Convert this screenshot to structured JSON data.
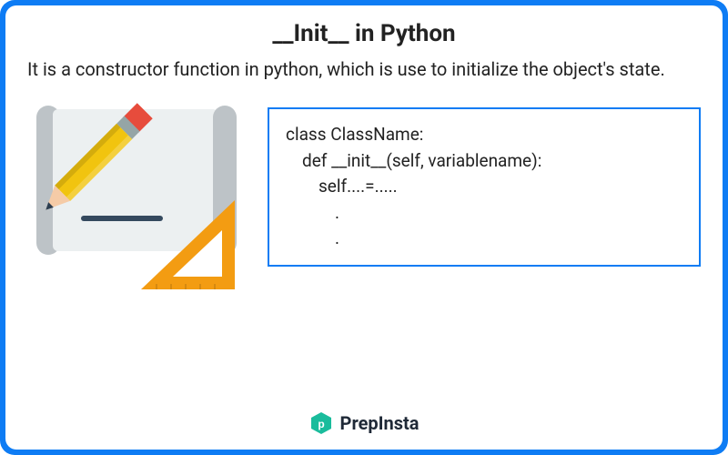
{
  "title": "__Init__ in Python",
  "subtitle": "It is a constructor function in python, which is use to initialize the object's state.",
  "code": {
    "l1": "class ClassName:",
    "l2": "def __init__(self, variablename):",
    "l3": "self....=.....",
    "l4a": ".",
    "l4b": "."
  },
  "brand": "PrepInsta"
}
